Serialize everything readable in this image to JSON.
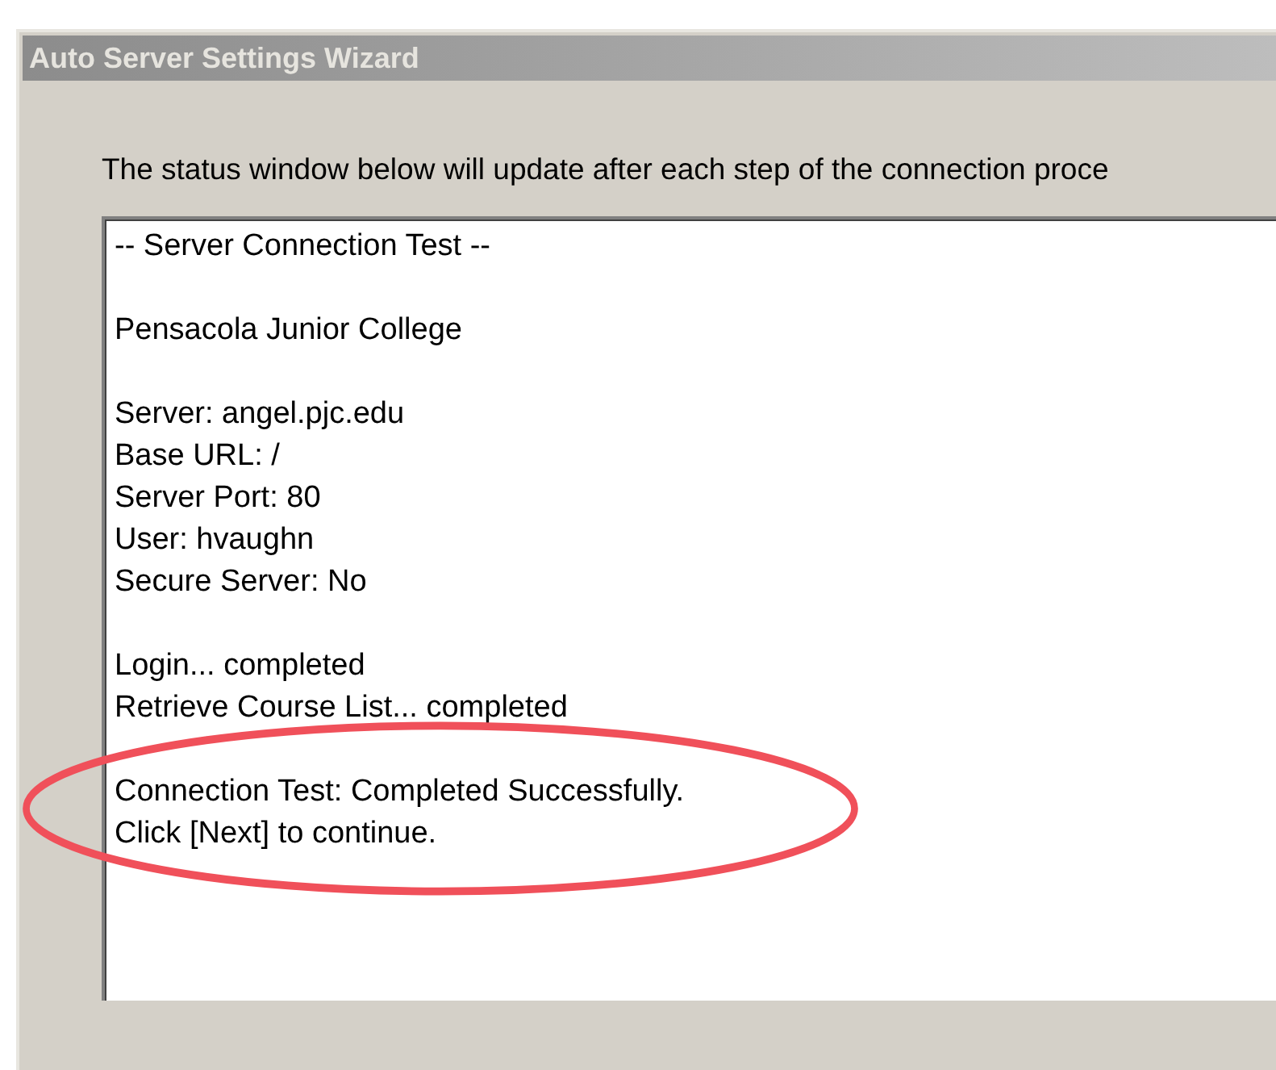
{
  "window": {
    "title": "Auto Server Settings Wizard"
  },
  "instruction": "The status window below will update after each step of the connection proce",
  "status_log": {
    "groups": [
      {
        "lines": [
          "-- Server Connection Test --"
        ],
        "highlighted": false
      },
      {
        "lines": [
          "Pensacola Junior College"
        ],
        "highlighted": false
      },
      {
        "lines": [
          "Server: angel.pjc.edu",
          "Base URL: /",
          "Server Port: 80",
          "User: hvaughn",
          "Secure Server: No"
        ],
        "highlighted": false
      },
      {
        "lines": [
          "Login... completed",
          "Retrieve Course List... completed"
        ],
        "highlighted": false
      },
      {
        "lines": [
          "Connection Test: Completed Successfully.",
          "Click [Next] to continue."
        ],
        "highlighted": true
      }
    ]
  }
}
